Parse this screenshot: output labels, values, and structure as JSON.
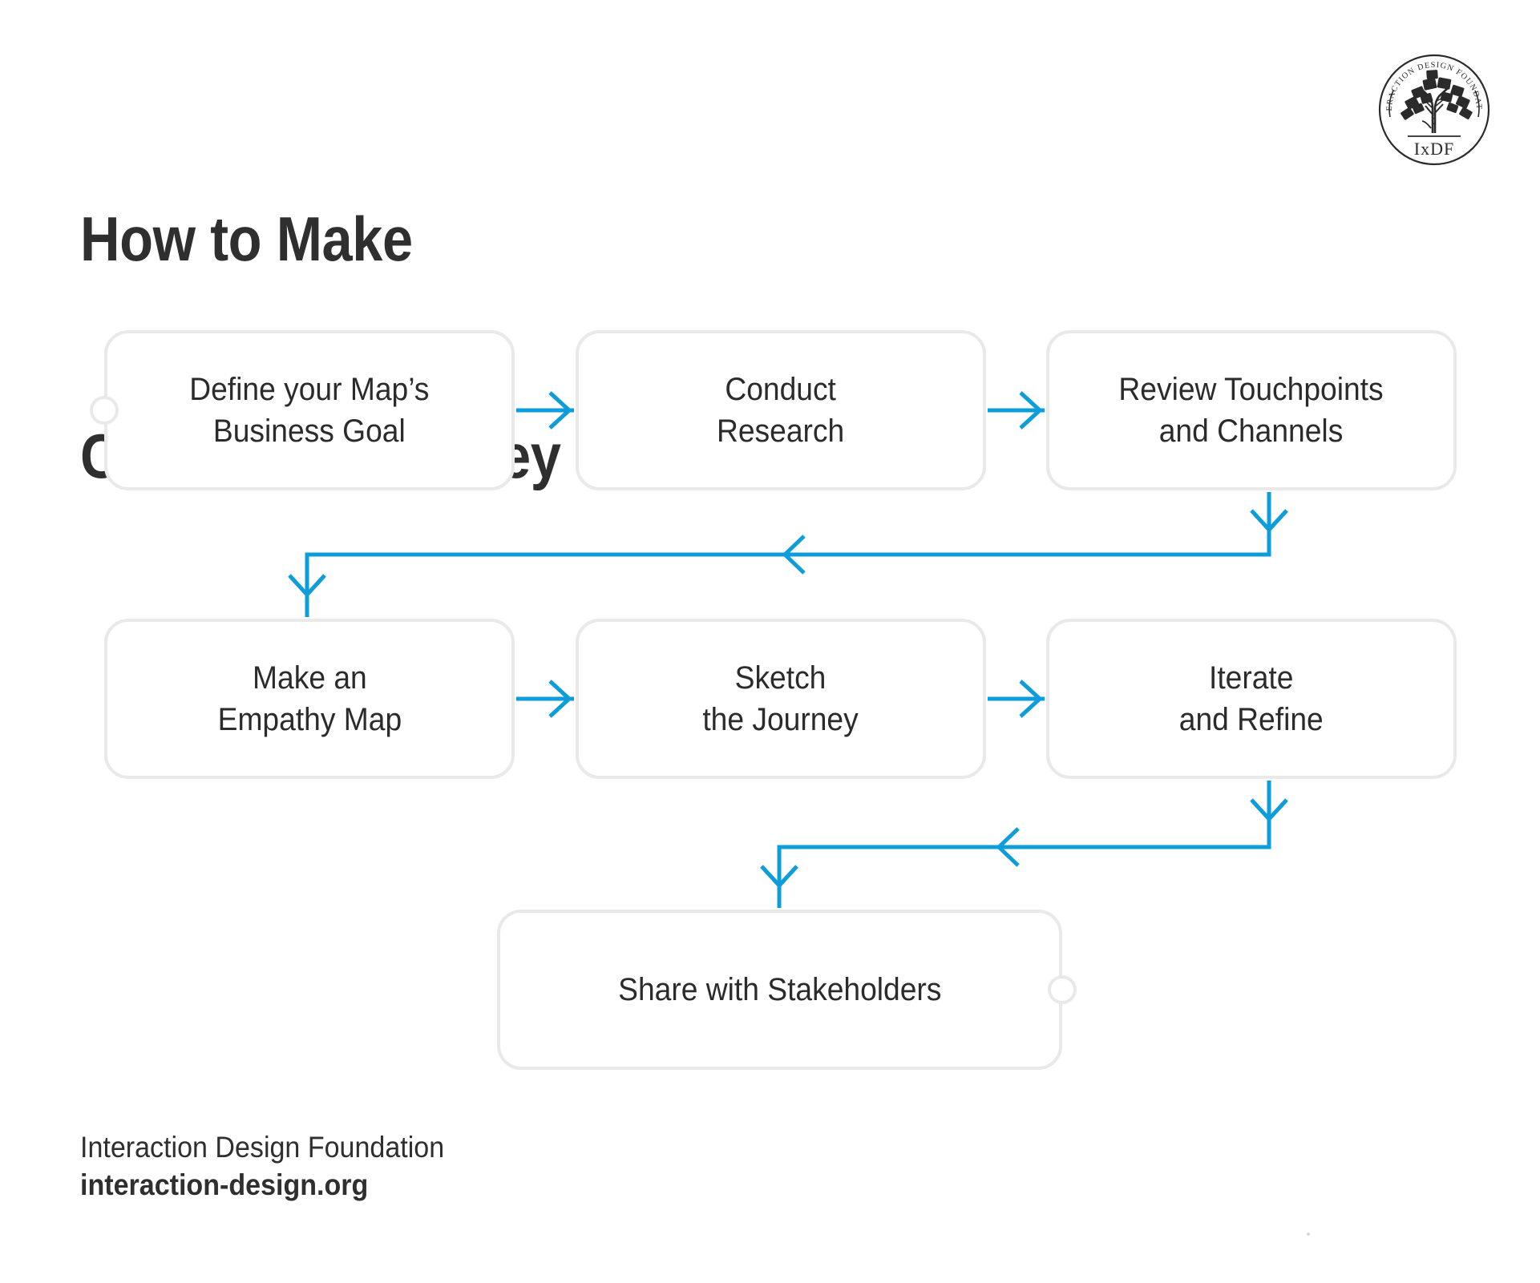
{
  "page": {
    "background": "#ffffff",
    "accent_blue": "#0d9ddb",
    "node_border": "#e9e9e9",
    "text_color": "#2b2b2b"
  },
  "title": {
    "line1": "How to Make",
    "line2": "Customer Journey Maps?"
  },
  "logo": {
    "name": "ixdf-seal-logo",
    "arc_text": "INTERACTION DESIGN FOUNDATION",
    "wordmark": "IxDF"
  },
  "flow": {
    "nodes": [
      {
        "id": "n1",
        "label": "Define your Map’s\nBusiness Goal"
      },
      {
        "id": "n2",
        "label": "Conduct\nResearch"
      },
      {
        "id": "n3",
        "label": "Review Touchpoints\nand Channels"
      },
      {
        "id": "n4",
        "label": "Make an\nEmpathy Map"
      },
      {
        "id": "n5",
        "label": "Sketch\nthe Journey"
      },
      {
        "id": "n6",
        "label": "Iterate\nand Refine"
      },
      {
        "id": "n7",
        "label": "Share with Stakeholders"
      }
    ],
    "endpoints": [
      {
        "id": "start",
        "name": "flow-start-node"
      },
      {
        "id": "end",
        "name": "flow-end-node"
      }
    ],
    "connectors": [
      {
        "from": "n1",
        "to": "n2",
        "kind": "arrow-right"
      },
      {
        "from": "n2",
        "to": "n3",
        "kind": "arrow-right"
      },
      {
        "from": "n3",
        "to": "n4",
        "kind": "elbow-down-left-down"
      },
      {
        "from": "n4",
        "to": "n5",
        "kind": "arrow-right"
      },
      {
        "from": "n5",
        "to": "n6",
        "kind": "arrow-right"
      },
      {
        "from": "n6",
        "to": "n7",
        "kind": "elbow-down-left-down"
      }
    ]
  },
  "footer": {
    "organization": "Interaction Design Foundation",
    "url": "interaction-design.org"
  }
}
